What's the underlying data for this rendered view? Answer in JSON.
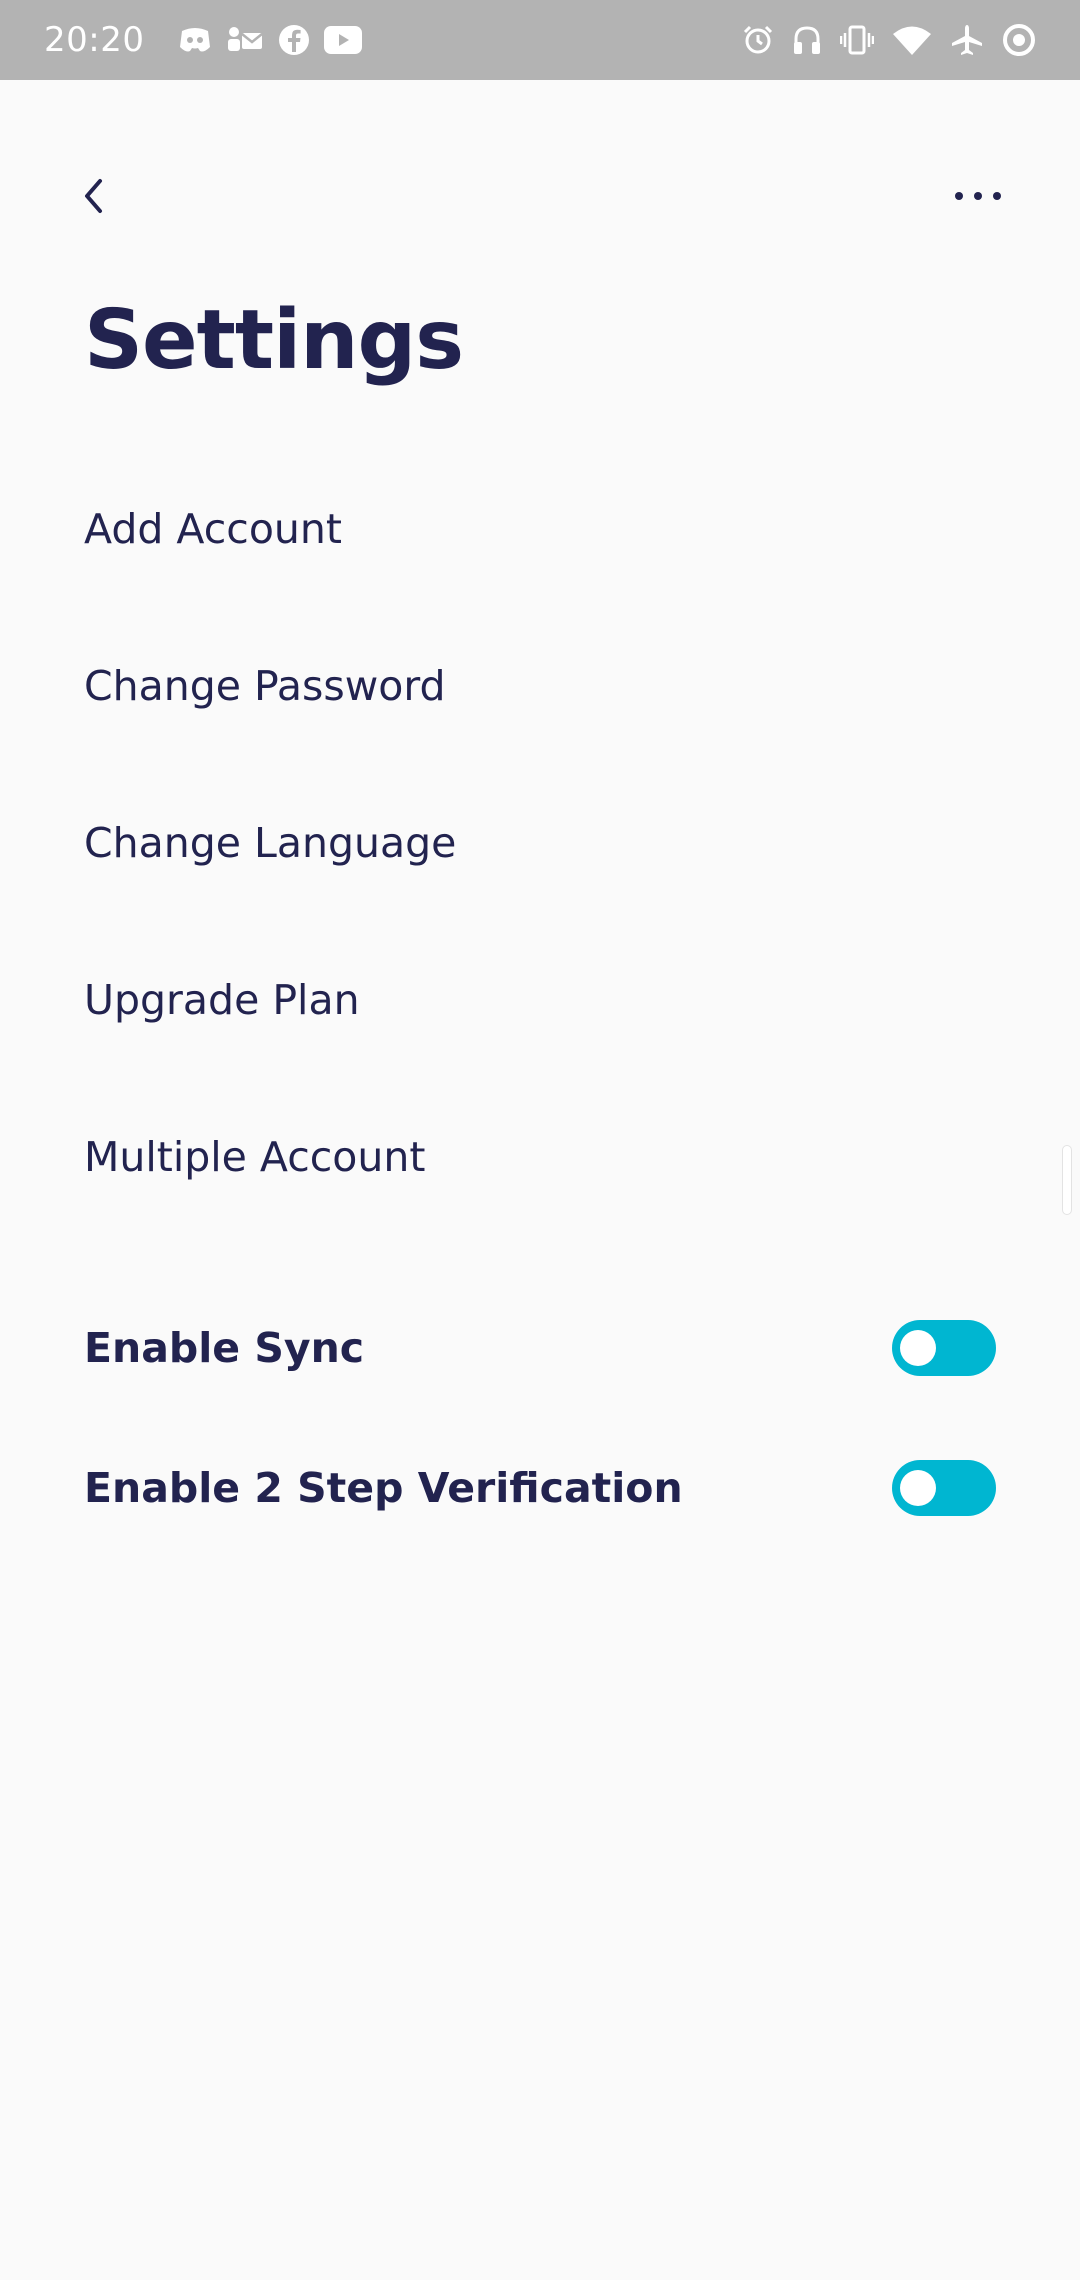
{
  "status_bar": {
    "time": "20:20",
    "left_icons": [
      "discord-icon",
      "mail-contacts-icon",
      "facebook-icon",
      "youtube-icon"
    ],
    "right_icons": [
      "alarm-icon",
      "headset-icon",
      "vibrate-icon",
      "wifi-icon",
      "airplane-mode-icon",
      "data-saver-icon"
    ]
  },
  "header": {
    "back_icon": "chevron-left-icon",
    "more_icon": "more-horizontal-icon",
    "title": "Settings"
  },
  "menu": {
    "items": [
      {
        "label": "Add Account"
      },
      {
        "label": "Change Password"
      },
      {
        "label": "Change Language"
      },
      {
        "label": "Upgrade Plan"
      },
      {
        "label": "Multiple Account"
      }
    ]
  },
  "toggles": {
    "sync_label": "Enable Sync",
    "two_step_label": "Enable 2 Step Verification"
  },
  "colors": {
    "text": "#22234f",
    "accent": "#00b6d1",
    "status_bar": "#b3b3b3",
    "background": "#fafafa"
  }
}
